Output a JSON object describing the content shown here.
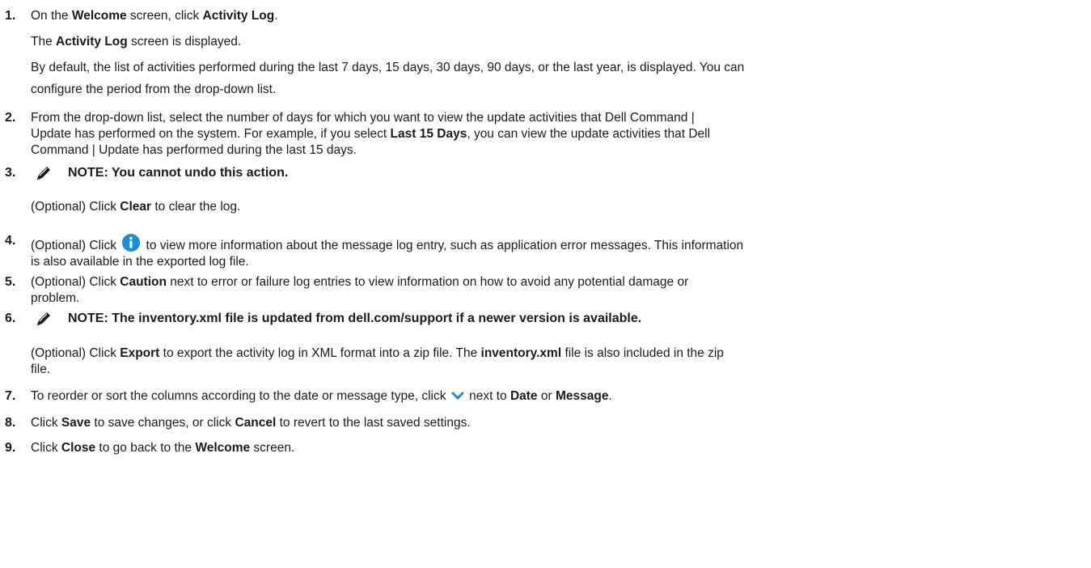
{
  "steps": [
    {
      "num": "1.",
      "parts": [
        {
          "text": "On the "
        },
        {
          "text": "Welcome",
          "bold": true
        },
        {
          "text": " screen, click "
        },
        {
          "text": "Activity Log",
          "bold": true
        },
        {
          "text": "."
        }
      ],
      "paras": [
        [
          {
            "text": "The "
          },
          {
            "text": "Activity Log",
            "bold": true
          },
          {
            "text": " screen is displayed."
          }
        ],
        [
          {
            "text": "By default, the list of activities performed during the last 7 days, 15 days, 30 days, 90 days, or the last year, is displayed. You can"
          }
        ],
        [
          {
            "text": "configure the period from the drop-down list."
          }
        ]
      ]
    },
    {
      "num": "2.",
      "lines": [
        [
          {
            "text": "From the drop-down list, select the number of days for which you want to view the update activities that Dell Command |"
          }
        ],
        [
          {
            "text": "Update has performed on the system. For example, if you select "
          },
          {
            "text": "Last 15 Days",
            "bold": true
          },
          {
            "text": ", you can view the update activities that Dell"
          }
        ],
        [
          {
            "text": "Command | Update has performed during the last 15 days."
          }
        ]
      ]
    },
    {
      "num": "3.",
      "note": "NOTE: You cannot undo this action.",
      "after": [
        {
          "text": "(Optional) Click "
        },
        {
          "text": "Clear",
          "bold": true
        },
        {
          "text": " to clear the log."
        }
      ]
    },
    {
      "num": "4.",
      "lines": [
        [
          {
            "text": "(Optional) Click "
          },
          {
            "icon": "info-icon"
          },
          {
            "text": " to view more information about the message log entry, such as application error messages. This information"
          }
        ],
        [
          {
            "text": "is also available in the exported log file."
          }
        ]
      ]
    },
    {
      "num": "5.",
      "lines": [
        [
          {
            "text": "(Optional) Click "
          },
          {
            "text": "Caution",
            "bold": true
          },
          {
            "text": " next to error or failure log entries to view information on how to avoid any potential damage or"
          }
        ],
        [
          {
            "text": "problem."
          }
        ]
      ]
    },
    {
      "num": "6.",
      "note": "NOTE: The inventory.xml file is updated from dell.com/support if a newer version is available.",
      "after_lines": [
        [
          {
            "text": "(Optional) Click "
          },
          {
            "text": "Export",
            "bold": true
          },
          {
            "text": " to export the activity log in XML format into a zip file. The "
          },
          {
            "text": "inventory.xml",
            "bold": true
          },
          {
            "text": " file is also included in the zip"
          }
        ],
        [
          {
            "text": "file."
          }
        ]
      ]
    },
    {
      "num": "7.",
      "lines": [
        [
          {
            "text": "To reorder or sort the columns according to the date or message type, click "
          },
          {
            "icon": "chevron-down-icon"
          },
          {
            "text": " next to "
          },
          {
            "text": "Date",
            "bold": true
          },
          {
            "text": " or "
          },
          {
            "text": "Message",
            "bold": true
          },
          {
            "text": "."
          }
        ]
      ]
    },
    {
      "num": "8.",
      "lines": [
        [
          {
            "text": "Click "
          },
          {
            "text": "Save",
            "bold": true
          },
          {
            "text": " to save changes, or click "
          },
          {
            "text": "Cancel",
            "bold": true
          },
          {
            "text": " to revert to the last saved settings."
          }
        ]
      ]
    },
    {
      "num": "9.",
      "lines": [
        [
          {
            "text": "Click "
          },
          {
            "text": "Close",
            "bold": true
          },
          {
            "text": " to go back to the "
          },
          {
            "text": "Welcome",
            "bold": true
          },
          {
            "text": " screen."
          }
        ]
      ]
    }
  ],
  "colors": {
    "text": "#1b1b1b",
    "info_icon": "#1a8fd6",
    "chevron": "#1a8fd6"
  }
}
